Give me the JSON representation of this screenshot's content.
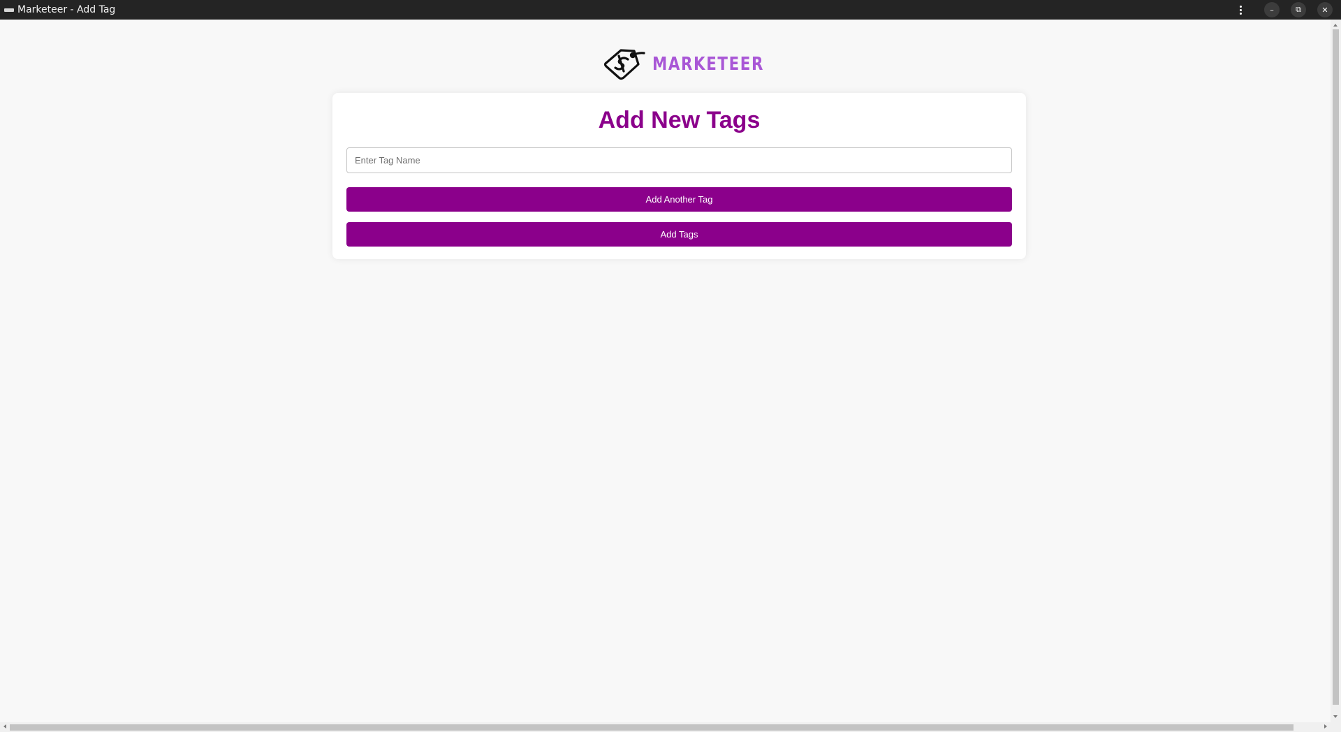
{
  "window": {
    "title": "Marketeer - Add Tag",
    "controls": {
      "menu_icon": "kebab-menu-icon",
      "minimize_glyph": "–",
      "restore_glyph": "⧉",
      "close_glyph": "✕"
    }
  },
  "brand": {
    "name": "MARKETEER",
    "logo_icon": "price-tag-dollar-icon",
    "color": "#a957d6"
  },
  "form": {
    "heading": "Add New Tags",
    "input_placeholder": "Enter Tag Name",
    "input_value": "",
    "add_another_label": "Add Another Tag",
    "submit_label": "Add Tags"
  },
  "colors": {
    "accent": "#8b008b",
    "titlebar": "#242424",
    "page_background": "#f8f8f8",
    "card_background": "#ffffff"
  }
}
